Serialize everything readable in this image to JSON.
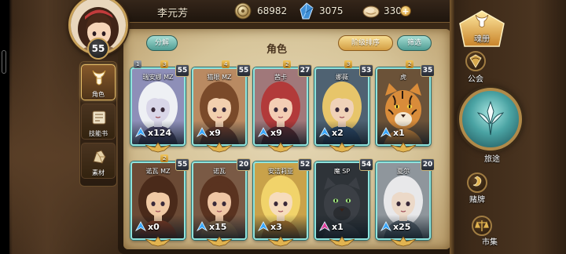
{
  "player": {
    "name": "李元芳",
    "level": "55"
  },
  "resources": {
    "coins": "68982",
    "crystals": "3075",
    "food": "330",
    "add_label": "+"
  },
  "panel": {
    "disband_label": "分解",
    "title": "角色",
    "sort_label": "阶级排序",
    "filter_label": "筛选"
  },
  "side_tabs": [
    {
      "label": "角色",
      "icon": "helmet-icon",
      "selected": true
    },
    {
      "label": "技能书",
      "icon": "skill-book-icon",
      "selected": false
    },
    {
      "label": "素材",
      "icon": "material-icon",
      "selected": false
    }
  ],
  "right_menu": [
    {
      "label": "魂册",
      "icon": "soul-book-icon",
      "selected": true
    },
    {
      "label": "公会",
      "icon": "guild-icon"
    },
    {
      "label": "旅途",
      "icon": "journey-icon"
    },
    {
      "label": "赌牌",
      "icon": "card-game-icon"
    },
    {
      "label": "市集",
      "icon": "market-icon"
    }
  ],
  "cards": [
    {
      "name": "瑞安娜 MZ",
      "level": "55",
      "count": "x124",
      "tag_left": "1",
      "tag": "3"
    },
    {
      "name": "猫眼 MZ",
      "level": "55",
      "count": "x9",
      "tag": "4"
    },
    {
      "name": "茜卡",
      "level": "27",
      "count": "x9",
      "tag": "2"
    },
    {
      "name": "娜薇",
      "level": "53",
      "count": "x2",
      "tag": "3"
    },
    {
      "name": "虎",
      "level": "35",
      "count": "x1",
      "tag": "2"
    },
    {
      "name": "诺瓦 MZ",
      "level": "55",
      "count": "x0",
      "tag": "2"
    },
    {
      "name": "诺瓦",
      "level": "20",
      "count": "x15"
    },
    {
      "name": "安洁莉亚",
      "level": "52",
      "count": "x3"
    },
    {
      "name": "魔 SP",
      "level": "54",
      "count": "x1"
    },
    {
      "name": "夏尔",
      "level": "20",
      "count": "x25"
    }
  ],
  "colors": {
    "accent_teal": "#8fe3dc",
    "gold": "#e2b450",
    "parchment": "#d7c59a"
  }
}
